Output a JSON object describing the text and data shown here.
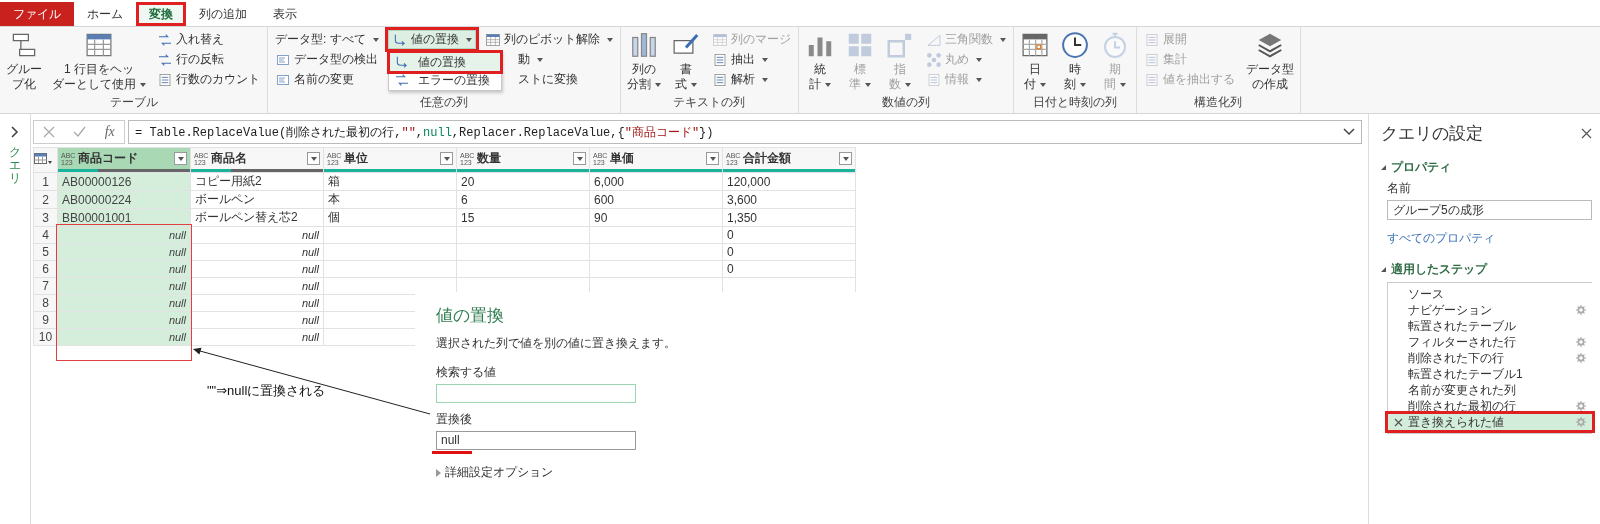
{
  "ribbon_tabs": [
    {
      "label": "ファイル",
      "kind": "file",
      "selected": false,
      "highlighted": false
    },
    {
      "label": "ホーム",
      "kind": "tab",
      "selected": false,
      "highlighted": false
    },
    {
      "label": "変換",
      "kind": "tab",
      "selected": true,
      "highlighted": true
    },
    {
      "label": "列の追加",
      "kind": "tab",
      "selected": false,
      "highlighted": false
    },
    {
      "label": "表示",
      "kind": "tab",
      "selected": false,
      "highlighted": false
    }
  ],
  "ribbon_groups": [
    {
      "label": "テーブル",
      "sections": [
        {
          "kind": "large",
          "label_lines": [
            "グルー",
            "プ化"
          ],
          "dropdown": false,
          "disabled": false
        },
        {
          "kind": "large",
          "label_lines": [
            "1 行目をヘッ",
            "ダーとして使用"
          ],
          "dropdown": true,
          "disabled": false
        },
        {
          "kind": "stack",
          "items": [
            {
              "label": "入れ替え",
              "dropdown": false,
              "disabled": false,
              "pressed": false,
              "highlighted": false,
              "covered": false
            },
            {
              "label": "行の反転",
              "dropdown": false,
              "disabled": false,
              "pressed": false,
              "highlighted": false,
              "covered": false
            },
            {
              "label": "行数のカウント",
              "dropdown": false,
              "disabled": false,
              "pressed": false,
              "highlighted": false,
              "covered": false
            }
          ]
        }
      ]
    },
    {
      "label": "任意の列",
      "sections": [
        {
          "kind": "stack",
          "items": [
            {
              "label": "データ型: すべて",
              "dropdown": true,
              "disabled": false,
              "pressed": false,
              "highlighted": false,
              "covered": false
            },
            {
              "label": "データ型の検出",
              "dropdown": false,
              "disabled": false,
              "pressed": false,
              "highlighted": false,
              "covered": false
            },
            {
              "label": "名前の変更",
              "dropdown": false,
              "disabled": false,
              "pressed": false,
              "highlighted": false,
              "covered": false
            }
          ]
        },
        {
          "kind": "stack",
          "items": [
            {
              "label": "値の置換",
              "dropdown": true,
              "disabled": false,
              "pressed": true,
              "highlighted": true,
              "covered": false,
              "menu": {
                "items": [
                  {
                    "label": "値の置換",
                    "selected": true,
                    "highlighted": true
                  },
                  {
                    "label": "エラーの置換",
                    "selected": false,
                    "highlighted": false
                  }
                ]
              }
            }
          ]
        },
        {
          "kind": "stack",
          "items": [
            {
              "label": "列のピボット解除",
              "dropdown": true,
              "disabled": false,
              "pressed": false,
              "highlighted": false,
              "covered": false
            },
            {
              "label": "動",
              "dropdown": true,
              "disabled": false,
              "pressed": false,
              "highlighted": false,
              "covered": true
            },
            {
              "label": "ストに変換",
              "dropdown": false,
              "disabled": false,
              "pressed": false,
              "highlighted": false,
              "covered": true
            }
          ]
        }
      ]
    },
    {
      "label": "テキストの列",
      "sections": [
        {
          "kind": "large",
          "label_lines": [
            "列の",
            "分割"
          ],
          "dropdown": true,
          "disabled": false
        },
        {
          "kind": "large",
          "label_lines": [
            "書",
            "式"
          ],
          "dropdown": true,
          "disabled": false
        },
        {
          "kind": "stack",
          "items": [
            {
              "label": "列のマージ",
              "dropdown": false,
              "disabled": true,
              "pressed": false,
              "highlighted": false,
              "covered": false
            },
            {
              "label": "抽出",
              "dropdown": true,
              "disabled": false,
              "pressed": false,
              "highlighted": false,
              "covered": false
            },
            {
              "label": "解析",
              "dropdown": true,
              "disabled": false,
              "pressed": false,
              "highlighted": false,
              "covered": false
            }
          ]
        }
      ]
    },
    {
      "label": "数値の列",
      "sections": [
        {
          "kind": "large",
          "label_lines": [
            "統",
            "計"
          ],
          "dropdown": true,
          "disabled": false
        },
        {
          "kind": "large",
          "label_lines": [
            "標",
            "準"
          ],
          "dropdown": true,
          "disabled": true
        },
        {
          "kind": "large",
          "label_lines": [
            "指",
            "数"
          ],
          "dropdown": true,
          "disabled": true
        },
        {
          "kind": "stack",
          "items": [
            {
              "label": "三角関数",
              "dropdown": true,
              "disabled": true,
              "pressed": false,
              "highlighted": false,
              "covered": false
            },
            {
              "label": "丸め",
              "dropdown": true,
              "disabled": true,
              "pressed": false,
              "highlighted": false,
              "covered": false
            },
            {
              "label": "情報",
              "dropdown": true,
              "disabled": true,
              "pressed": false,
              "highlighted": false,
              "covered": false
            }
          ]
        }
      ]
    },
    {
      "label": "日付と時刻の列",
      "sections": [
        {
          "kind": "large",
          "label_lines": [
            "日",
            "付"
          ],
          "dropdown": true,
          "disabled": false
        },
        {
          "kind": "large",
          "label_lines": [
            "時",
            "刻"
          ],
          "dropdown": true,
          "disabled": false
        },
        {
          "kind": "large",
          "label_lines": [
            "期",
            "間"
          ],
          "dropdown": true,
          "disabled": true
        }
      ]
    },
    {
      "label": "構造化列",
      "sections": [
        {
          "kind": "stack",
          "items": [
            {
              "label": "展開",
              "dropdown": false,
              "disabled": true,
              "pressed": false,
              "highlighted": false,
              "covered": false
            },
            {
              "label": "集計",
              "dropdown": false,
              "disabled": true,
              "pressed": false,
              "highlighted": false,
              "covered": false
            },
            {
              "label": "値を抽出する",
              "dropdown": false,
              "disabled": true,
              "pressed": false,
              "highlighted": false,
              "covered": false
            }
          ]
        },
        {
          "kind": "large",
          "label_lines": [
            "データ型",
            "の作成"
          ],
          "dropdown": false,
          "disabled": false
        }
      ]
    }
  ],
  "queries_pane": {
    "label": "クエリ"
  },
  "formula_bar": {
    "fx_label": "fx",
    "tokens": [
      {
        "text": "= Table.ReplaceValue(削除された最初の行,",
        "kind": "plain"
      },
      {
        "text": "\"\"",
        "kind": "string"
      },
      {
        "text": ",",
        "kind": "plain"
      },
      {
        "text": "null",
        "kind": "keyword"
      },
      {
        "text": ",Replacer.ReplaceValue,{",
        "kind": "plain"
      },
      {
        "text": "\"商品コード\"",
        "kind": "string"
      },
      {
        "text": "})",
        "kind": "plain"
      }
    ]
  },
  "table": {
    "columns": [
      {
        "name": "商品コード",
        "type_lines": [
          "ABC",
          "123"
        ],
        "selected": true,
        "level": 0.3
      },
      {
        "name": "商品名",
        "type_lines": [
          "ABC",
          "123"
        ],
        "selected": false,
        "level": 0.3
      },
      {
        "name": "単位",
        "type_lines": [
          "ABC",
          "123"
        ],
        "selected": false,
        "level": 1
      },
      {
        "name": "数量",
        "type_lines": [
          "ABC",
          "123"
        ],
        "selected": false,
        "level": 1
      },
      {
        "name": "単価",
        "type_lines": [
          "ABC",
          "123"
        ],
        "selected": false,
        "level": 1
      },
      {
        "name": "合計金額",
        "type_lines": [
          "ABC",
          "123"
        ],
        "selected": false,
        "level": 1
      }
    ],
    "rows": [
      {
        "number": "1",
        "cells": [
          {
            "kind": "text",
            "value": "AB00000126"
          },
          {
            "kind": "text",
            "value": "コピー用紙2"
          },
          {
            "kind": "text",
            "value": "箱"
          },
          {
            "kind": "text",
            "value": "20"
          },
          {
            "kind": "text",
            "value": "6,000"
          },
          {
            "kind": "text",
            "value": "120,000"
          }
        ]
      },
      {
        "number": "2",
        "cells": [
          {
            "kind": "text",
            "value": "AB00000224"
          },
          {
            "kind": "text",
            "value": "ボールペン"
          },
          {
            "kind": "text",
            "value": "本"
          },
          {
            "kind": "text",
            "value": "6"
          },
          {
            "kind": "text",
            "value": "600"
          },
          {
            "kind": "text",
            "value": "3,600"
          }
        ]
      },
      {
        "number": "3",
        "cells": [
          {
            "kind": "text",
            "value": "BB00001001"
          },
          {
            "kind": "text",
            "value": "ボールペン替え芯2"
          },
          {
            "kind": "text",
            "value": "個"
          },
          {
            "kind": "text",
            "value": "15"
          },
          {
            "kind": "text",
            "value": "90"
          },
          {
            "kind": "text",
            "value": "1,350"
          }
        ]
      },
      {
        "number": "4",
        "cells": [
          {
            "kind": "null",
            "value": "null"
          },
          {
            "kind": "null",
            "value": "null"
          },
          {
            "kind": "empty"
          },
          {
            "kind": "empty"
          },
          {
            "kind": "empty"
          },
          {
            "kind": "text",
            "value": "0"
          }
        ]
      },
      {
        "number": "5",
        "cells": [
          {
            "kind": "null",
            "value": "null"
          },
          {
            "kind": "null",
            "value": "null"
          },
          {
            "kind": "empty"
          },
          {
            "kind": "empty"
          },
          {
            "kind": "empty"
          },
          {
            "kind": "text",
            "value": "0"
          }
        ]
      },
      {
        "number": "6",
        "cells": [
          {
            "kind": "null",
            "value": "null"
          },
          {
            "kind": "null",
            "value": "null"
          },
          {
            "kind": "empty"
          },
          {
            "kind": "empty"
          },
          {
            "kind": "empty"
          },
          {
            "kind": "text",
            "value": "0"
          }
        ]
      },
      {
        "number": "7",
        "cells": [
          {
            "kind": "null",
            "value": "null"
          },
          {
            "kind": "null",
            "value": "null"
          },
          {
            "kind": "empty"
          },
          {
            "kind": "empty"
          },
          {
            "kind": "empty"
          },
          {
            "kind": "empty"
          }
        ]
      },
      {
        "number": "8",
        "cells": [
          {
            "kind": "null",
            "value": "null"
          },
          {
            "kind": "null",
            "value": "null"
          },
          {
            "kind": "empty"
          },
          {
            "kind": "empty"
          },
          {
            "kind": "empty"
          },
          {
            "kind": "empty"
          }
        ]
      },
      {
        "number": "9",
        "cells": [
          {
            "kind": "null",
            "value": "null"
          },
          {
            "kind": "null",
            "value": "null"
          },
          {
            "kind": "empty"
          },
          {
            "kind": "empty"
          },
          {
            "kind": "empty"
          },
          {
            "kind": "empty"
          }
        ]
      },
      {
        "number": "10",
        "cells": [
          {
            "kind": "null",
            "value": "null"
          },
          {
            "kind": "null",
            "value": "null"
          },
          {
            "kind": "empty"
          },
          {
            "kind": "empty"
          },
          {
            "kind": "empty"
          },
          {
            "kind": "empty"
          }
        ]
      }
    ]
  },
  "annotation": {
    "text": "\"\"⇒nullに置換される"
  },
  "dialog": {
    "title": "値の置換",
    "description": "選択された列で値を別の値に置き換えます。",
    "fields": [
      {
        "label": "検索する値",
        "focused": true,
        "highlighted": false
      },
      {
        "label": "置換後",
        "value": "null",
        "focused": false,
        "highlighted": true
      }
    ],
    "advanced": {
      "label": "詳細設定オプション",
      "expanded": false
    }
  },
  "query_settings": {
    "title": "クエリの設定",
    "properties": {
      "heading": "プロパティ",
      "expanded": true,
      "name_label": "名前",
      "name_value": "グループ5の成形",
      "all_link": "すべてのプロパティ"
    },
    "steps": {
      "heading": "適用したステップ",
      "expanded": true,
      "items": [
        {
          "label": "ソース",
          "has_settings": false,
          "selected": false,
          "highlighted": false
        },
        {
          "label": "ナビゲーション",
          "has_settings": true,
          "selected": false,
          "highlighted": false
        },
        {
          "label": "転置されたテーブル",
          "has_settings": false,
          "selected": false,
          "highlighted": false
        },
        {
          "label": "フィルターされた行",
          "has_settings": true,
          "selected": false,
          "highlighted": false
        },
        {
          "label": "削除された下の行",
          "has_settings": true,
          "selected": false,
          "highlighted": false
        },
        {
          "label": "転置されたテーブル1",
          "has_settings": false,
          "selected": false,
          "highlighted": false
        },
        {
          "label": "名前が変更された列",
          "has_settings": false,
          "selected": false,
          "highlighted": false
        },
        {
          "label": "削除された最初の行",
          "has_settings": true,
          "selected": false,
          "highlighted": false
        },
        {
          "label": "置き換えられた値",
          "has_settings": true,
          "selected": true,
          "highlighted": true
        }
      ]
    }
  }
}
